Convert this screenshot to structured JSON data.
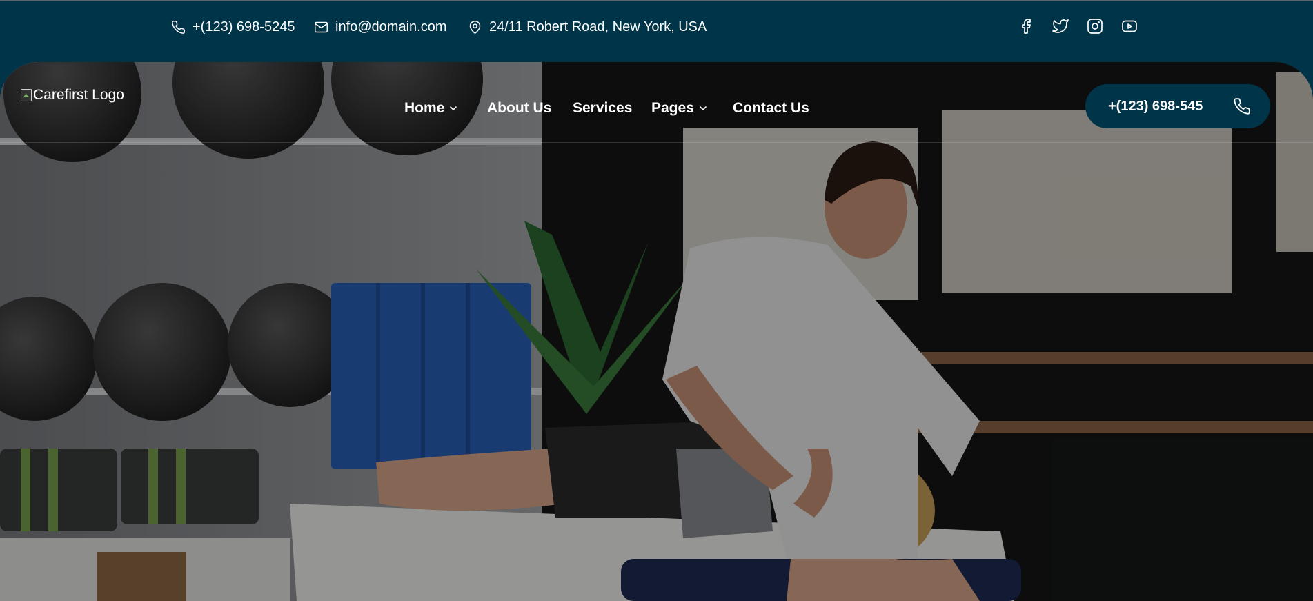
{
  "topbar": {
    "phone": "+(123) 698-5245",
    "email": "info@domain.com",
    "address": "24/11 Robert Road, New York, USA",
    "phone_icon": "phone-icon",
    "email_icon": "mail-icon",
    "address_icon": "map-pin-icon",
    "socials": [
      "facebook-icon",
      "twitter-icon",
      "instagram-icon",
      "youtube-icon"
    ]
  },
  "header": {
    "logo_alt": "Carefirst Logo",
    "nav": [
      {
        "label": "Home",
        "has_dropdown": true
      },
      {
        "label": "About Us",
        "has_dropdown": false
      },
      {
        "label": "Services",
        "has_dropdown": false
      },
      {
        "label": "Pages",
        "has_dropdown": true
      },
      {
        "label": "Contact Us",
        "has_dropdown": false
      }
    ],
    "cta_phone": "+(123) 698-545"
  },
  "colors": {
    "brand_dark": "#003449",
    "text_light": "#ffffff"
  }
}
